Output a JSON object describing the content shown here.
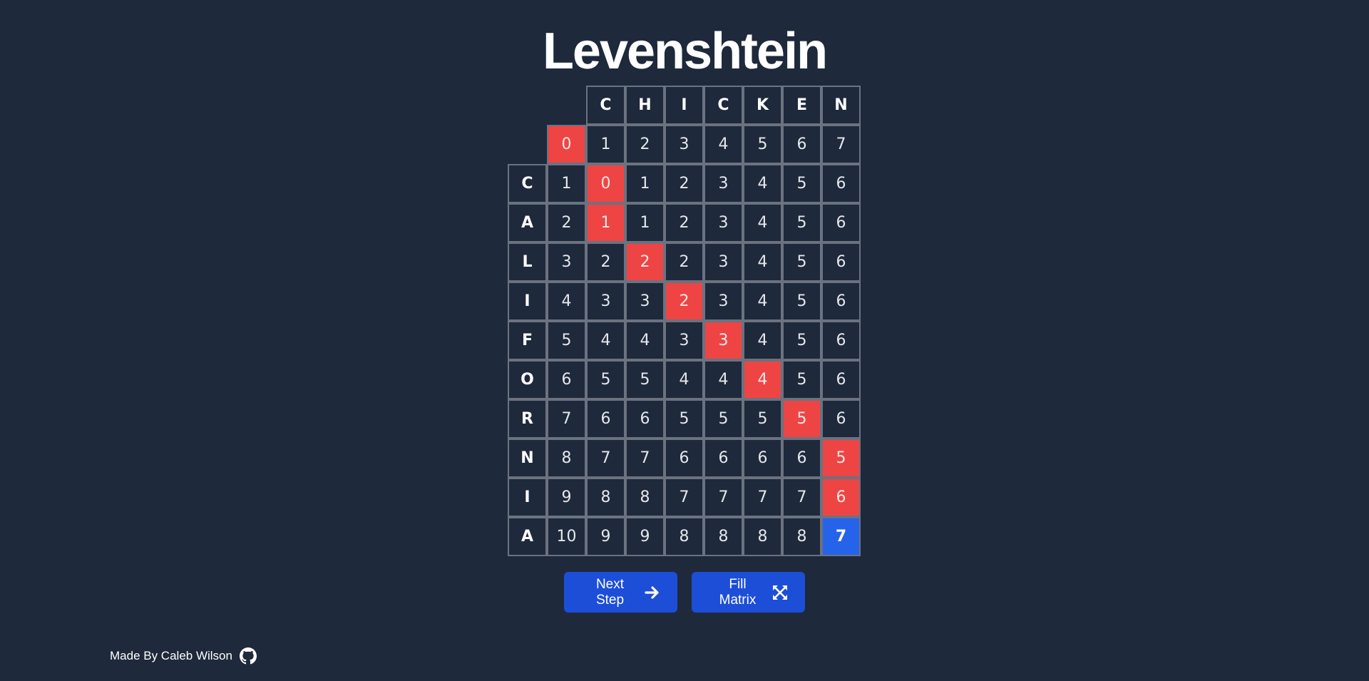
{
  "title": "Levenshtein",
  "matrix": {
    "word_top": [
      "C",
      "H",
      "I",
      "C",
      "K",
      "E",
      "N"
    ],
    "word_side": [
      "C",
      "A",
      "L",
      "I",
      "F",
      "O",
      "R",
      "N",
      "I",
      "A"
    ],
    "rows": [
      [
        "0",
        "1",
        "2",
        "3",
        "4",
        "5",
        "6",
        "7"
      ],
      [
        "1",
        "0",
        "1",
        "2",
        "3",
        "4",
        "5",
        "6"
      ],
      [
        "2",
        "1",
        "1",
        "2",
        "3",
        "4",
        "5",
        "6"
      ],
      [
        "3",
        "2",
        "2",
        "2",
        "3",
        "4",
        "5",
        "6"
      ],
      [
        "4",
        "3",
        "3",
        "2",
        "3",
        "4",
        "5",
        "6"
      ],
      [
        "5",
        "4",
        "4",
        "3",
        "3",
        "4",
        "5",
        "6"
      ],
      [
        "6",
        "5",
        "5",
        "4",
        "4",
        "4",
        "5",
        "6"
      ],
      [
        "7",
        "6",
        "6",
        "5",
        "5",
        "5",
        "5",
        "6"
      ],
      [
        "8",
        "7",
        "7",
        "6",
        "6",
        "6",
        "6",
        "5"
      ],
      [
        "9",
        "8",
        "8",
        "7",
        "7",
        "7",
        "7",
        "6"
      ],
      [
        "10",
        "9",
        "9",
        "8",
        "8",
        "8",
        "8",
        "7"
      ]
    ],
    "path": [
      [
        0,
        0
      ],
      [
        1,
        1
      ],
      [
        2,
        1
      ],
      [
        3,
        2
      ],
      [
        4,
        3
      ],
      [
        5,
        4
      ],
      [
        6,
        5
      ],
      [
        7,
        6
      ],
      [
        8,
        7
      ],
      [
        9,
        7
      ]
    ],
    "result": [
      10,
      7
    ],
    "colors": {
      "background": "#1e293b",
      "border": "#6b7280",
      "path": "#ef4444",
      "result": "#2563eb",
      "button": "#1d4ed8"
    }
  },
  "buttons": {
    "next_step": "Next Step",
    "next_step_icon": "arrow-right-icon",
    "fill_matrix": "Fill Matrix",
    "fill_matrix_icon": "expand-arrows-icon"
  },
  "footer": {
    "credit": "Made By Caleb Wilson",
    "icon": "github-icon"
  }
}
